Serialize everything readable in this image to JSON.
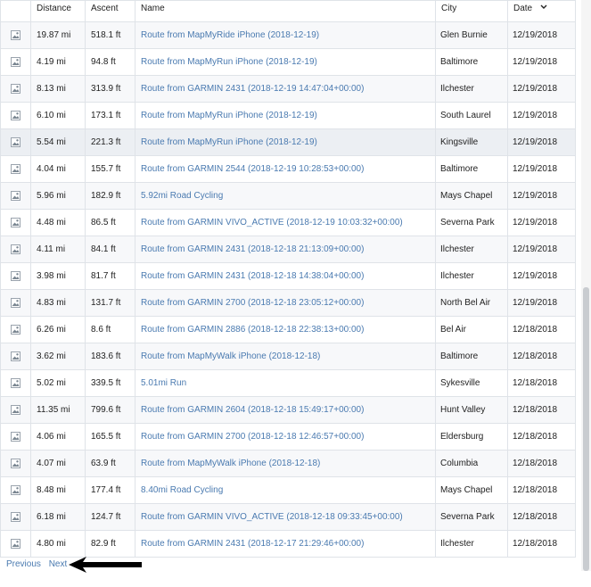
{
  "header": {
    "distance": "Distance",
    "ascent": "Ascent",
    "name": "Name",
    "city": "City",
    "date": "Date",
    "sort_icon": "chevron-down-icon"
  },
  "routes": [
    {
      "distance": "19.87 mi",
      "ascent": "518.1 ft",
      "name": "Route from MapMyRide iPhone (2018-12-19)",
      "city": "Glen Burnie",
      "date": "12/19/2018"
    },
    {
      "distance": "4.19 mi",
      "ascent": "94.8 ft",
      "name": "Route from MapMyRun iPhone (2018-12-19)",
      "city": "Baltimore",
      "date": "12/19/2018"
    },
    {
      "distance": "8.13 mi",
      "ascent": "313.9 ft",
      "name": "Route from GARMIN 2431 (2018-12-19 14:47:04+00:00)",
      "city": "Ilchester",
      "date": "12/19/2018"
    },
    {
      "distance": "6.10 mi",
      "ascent": "173.1 ft",
      "name": "Route from MapMyRun iPhone (2018-12-19)",
      "city": "South Laurel",
      "date": "12/19/2018"
    },
    {
      "distance": "5.54 mi",
      "ascent": "221.3 ft",
      "name": "Route from MapMyRun iPhone (2018-12-19)",
      "city": "Kingsville",
      "date": "12/19/2018"
    },
    {
      "distance": "4.04 mi",
      "ascent": "155.7 ft",
      "name": "Route from GARMIN 2544 (2018-12-19 10:28:53+00:00)",
      "city": "Baltimore",
      "date": "12/19/2018"
    },
    {
      "distance": "5.96 mi",
      "ascent": "182.9 ft",
      "name": "5.92mi Road Cycling",
      "city": "Mays Chapel",
      "date": "12/19/2018"
    },
    {
      "distance": "4.48 mi",
      "ascent": "86.5 ft",
      "name": "Route from GARMIN VIVO_ACTIVE (2018-12-19 10:03:32+00:00)",
      "city": "Severna Park",
      "date": "12/19/2018"
    },
    {
      "distance": "4.11 mi",
      "ascent": "84.1 ft",
      "name": "Route from GARMIN 2431 (2018-12-18 21:13:09+00:00)",
      "city": "Ilchester",
      "date": "12/19/2018"
    },
    {
      "distance": "3.98 mi",
      "ascent": "81.7 ft",
      "name": "Route from GARMIN 2431 (2018-12-18 14:38:04+00:00)",
      "city": "Ilchester",
      "date": "12/19/2018"
    },
    {
      "distance": "4.83 mi",
      "ascent": "131.7 ft",
      "name": "Route from GARMIN 2700 (2018-12-18 23:05:12+00:00)",
      "city": "North Bel Air",
      "date": "12/19/2018"
    },
    {
      "distance": "6.26 mi",
      "ascent": "8.6 ft",
      "name": "Route from GARMIN 2886 (2018-12-18 22:38:13+00:00)",
      "city": "Bel Air",
      "date": "12/18/2018"
    },
    {
      "distance": "3.62 mi",
      "ascent": "183.6 ft",
      "name": "Route from MapMyWalk iPhone (2018-12-18)",
      "city": "Baltimore",
      "date": "12/18/2018"
    },
    {
      "distance": "5.02 mi",
      "ascent": "339.5 ft",
      "name": "5.01mi Run",
      "city": "Sykesville",
      "date": "12/18/2018"
    },
    {
      "distance": "11.35 mi",
      "ascent": "799.6 ft",
      "name": "Route from GARMIN 2604 (2018-12-18 15:49:17+00:00)",
      "city": "Hunt Valley",
      "date": "12/18/2018"
    },
    {
      "distance": "4.06 mi",
      "ascent": "165.5 ft",
      "name": "Route from GARMIN 2700 (2018-12-18 12:46:57+00:00)",
      "city": "Eldersburg",
      "date": "12/18/2018"
    },
    {
      "distance": "4.07 mi",
      "ascent": "63.9 ft",
      "name": "Route from MapMyWalk iPhone (2018-12-18)",
      "city": "Columbia",
      "date": "12/18/2018"
    },
    {
      "distance": "8.48 mi",
      "ascent": "177.4 ft",
      "name": "8.40mi Road Cycling",
      "city": "Mays Chapel",
      "date": "12/18/2018"
    },
    {
      "distance": "6.18 mi",
      "ascent": "124.7 ft",
      "name": "Route from GARMIN VIVO_ACTIVE (2018-12-18 09:33:45+00:00)",
      "city": "Severna Park",
      "date": "12/18/2018"
    },
    {
      "distance": "4.80 mi",
      "ascent": "82.9 ft",
      "name": "Route from GARMIN 2431 (2018-12-17 21:29:46+00:00)",
      "city": "Ilchester",
      "date": "12/18/2018"
    }
  ],
  "row_icon": "broken-image-icon",
  "pager": {
    "previous": "Previous",
    "next": "Next"
  },
  "annotation_icon": "left-arrow-icon",
  "colors": {
    "link": "#4a7ab0",
    "row_alt": "#f7f8fa",
    "row_hover": "#eceff3",
    "arrow": "#000000"
  }
}
